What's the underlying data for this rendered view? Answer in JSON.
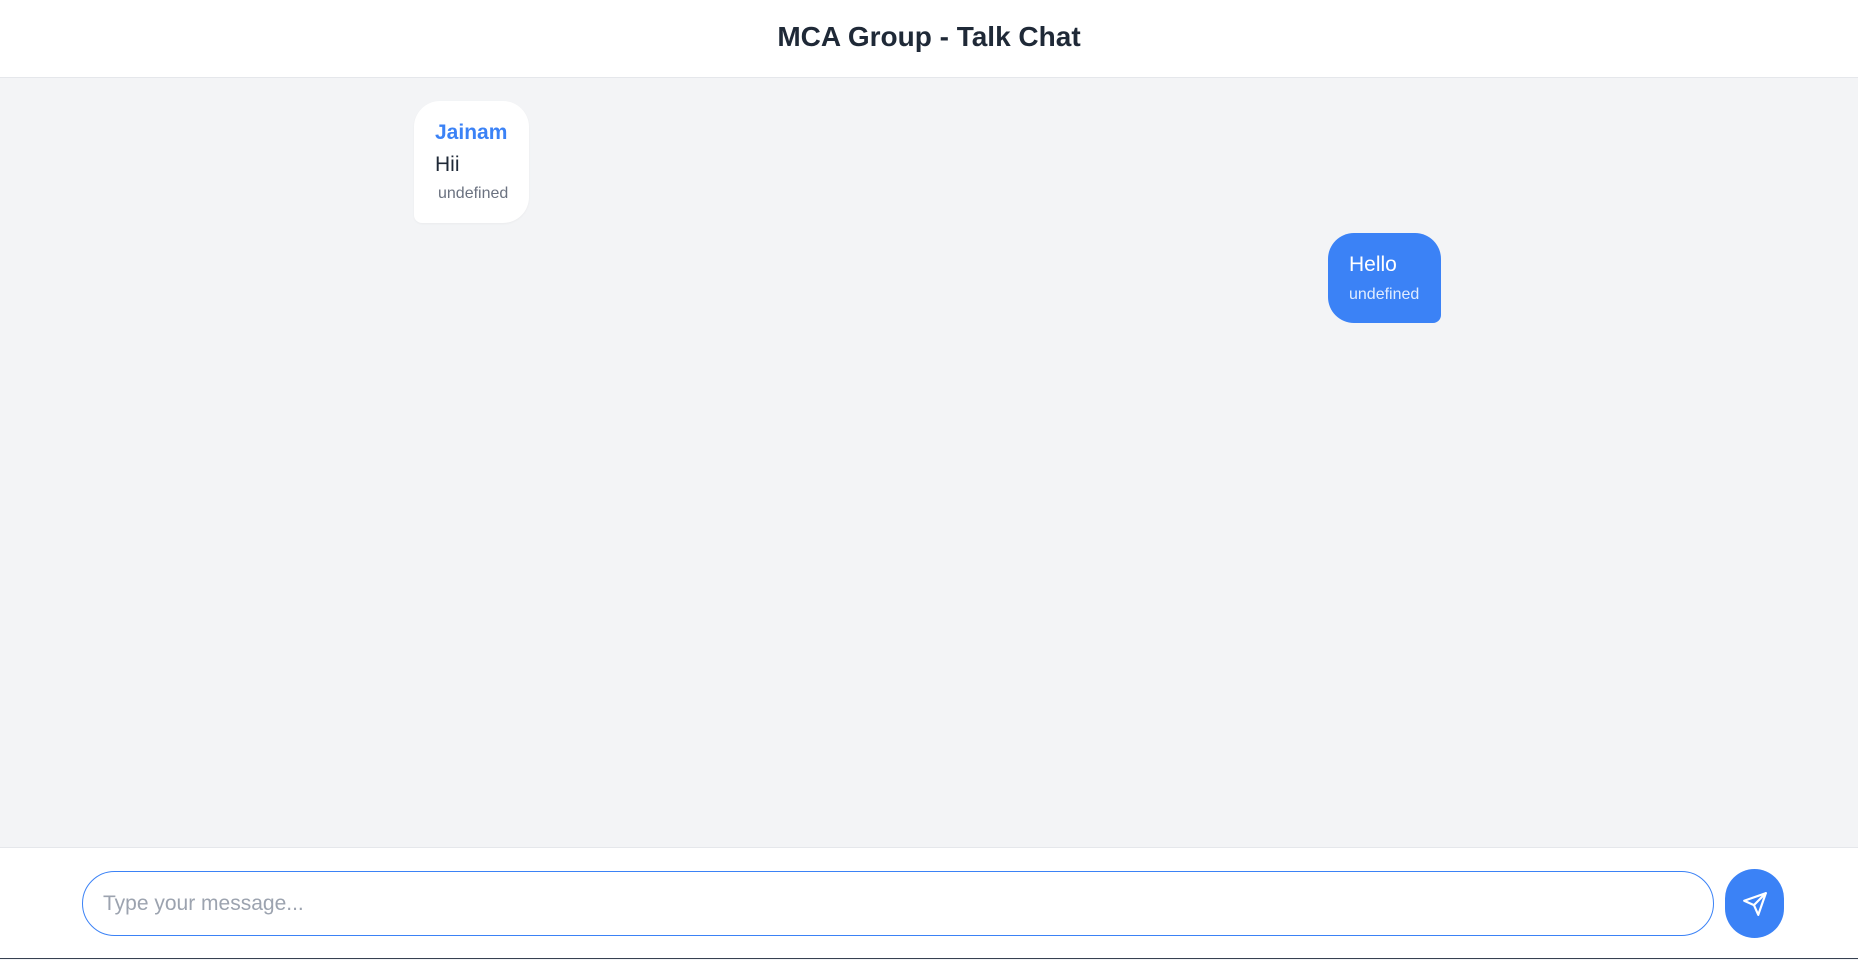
{
  "header": {
    "title": "MCA Group - Talk Chat"
  },
  "messages": [
    {
      "direction": "received",
      "sender": "Jainam",
      "text": "Hii",
      "timestamp": "undefined"
    },
    {
      "direction": "sent",
      "text": "Hello",
      "timestamp": "undefined"
    }
  ],
  "composer": {
    "placeholder": "Type your message...",
    "value": "",
    "send_icon": "send-icon"
  },
  "colors": {
    "accent": "#3b82f6",
    "background": "#f3f4f6",
    "received_bubble": "#ffffff",
    "sent_bubble": "#3b82f6",
    "title_text": "#1f2937"
  }
}
